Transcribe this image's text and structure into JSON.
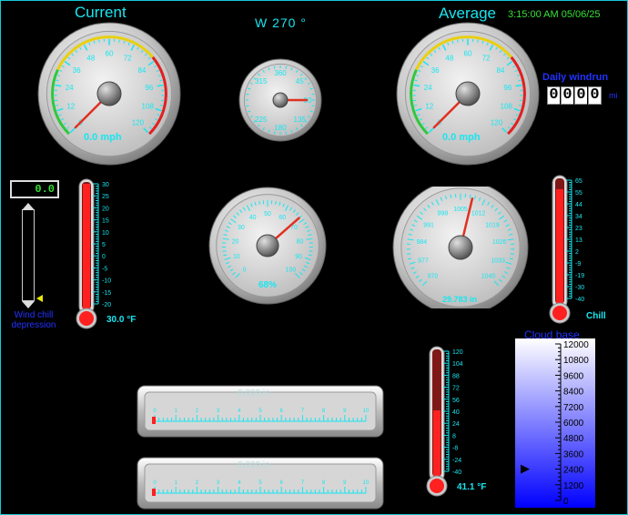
{
  "header": {
    "current_label": "Current",
    "average_label": "Average",
    "wind_direction": "W  270 °",
    "datetime": "3:15:00 AM 05/06/25"
  },
  "current_gauge": {
    "ticks": [
      "0",
      "12",
      "24",
      "36",
      "48",
      "60",
      "72",
      "84",
      "96",
      "108",
      "120"
    ],
    "readout": "0.0 mph",
    "value": 0,
    "max": 120
  },
  "average_gauge": {
    "ticks": [
      "0",
      "12",
      "24",
      "36",
      "48",
      "60",
      "72",
      "84",
      "96",
      "108",
      "120"
    ],
    "readout": "0.0 mph",
    "value": 0,
    "max": 120
  },
  "compass": {
    "labels": [
      "315",
      "360",
      "45",
      "90",
      "135",
      "180",
      "225"
    ],
    "direction_deg": 270
  },
  "daily_windrun": {
    "label": "Daily windrun",
    "digits": [
      "0",
      "0",
      "0",
      "0"
    ],
    "unit": "mi"
  },
  "wind_chill": {
    "readout": "0.0",
    "label_line1": "Wind chill",
    "label_line2": "depression"
  },
  "outdoor_thermometer": {
    "ticks": [
      "30",
      "25",
      "20",
      "15",
      "10",
      "5",
      "0",
      "-5",
      "-10",
      "-15",
      "-20"
    ],
    "readout": "30.0 °F",
    "value": 30,
    "min": -20,
    "max": 30
  },
  "humidity_gauge": {
    "ticks": [
      "0",
      "10",
      "20",
      "30",
      "40",
      "50",
      "60",
      "70",
      "80",
      "90",
      "100"
    ],
    "readout": "68%",
    "value": 68
  },
  "barometer_gauge": {
    "ticks": [
      "970",
      "977",
      "984",
      "991",
      "998",
      "1005",
      "1012",
      "1019",
      "1026",
      "1033",
      "1040"
    ],
    "readout": "29.783 in",
    "value": 1008.5
  },
  "chill_thermometer": {
    "ticks": [
      "65",
      "55",
      "44",
      "34",
      "23",
      "13",
      "2",
      "-9",
      "-19",
      "-30",
      "-40"
    ],
    "label": "Chill",
    "value": 57
  },
  "rain_bar_1": {
    "readout": "0.000 in",
    "ticks": [
      "0",
      "1",
      "2",
      "3",
      "4",
      "5",
      "6",
      "7",
      "8",
      "9",
      "10"
    ]
  },
  "rain_bar_2": {
    "readout": "0.000 in",
    "ticks": [
      "0",
      "1",
      "2",
      "3",
      "4",
      "5",
      "6",
      "7",
      "8",
      "9",
      "10"
    ]
  },
  "indoor_thermometer": {
    "ticks": [
      "120",
      "104",
      "88",
      "72",
      "56",
      "40",
      "24",
      "8",
      "-8",
      "-24",
      "-40"
    ],
    "readout": "41.1 °F",
    "value": 41.1,
    "min": -40,
    "max": 120
  },
  "cloud_base": {
    "title": "Cloud base",
    "ticks": [
      "12000",
      "10800",
      "9600",
      "8400",
      "7200",
      "6000",
      "4800",
      "3600",
      "2400",
      "1200",
      "0"
    ],
    "value": 2400
  }
}
